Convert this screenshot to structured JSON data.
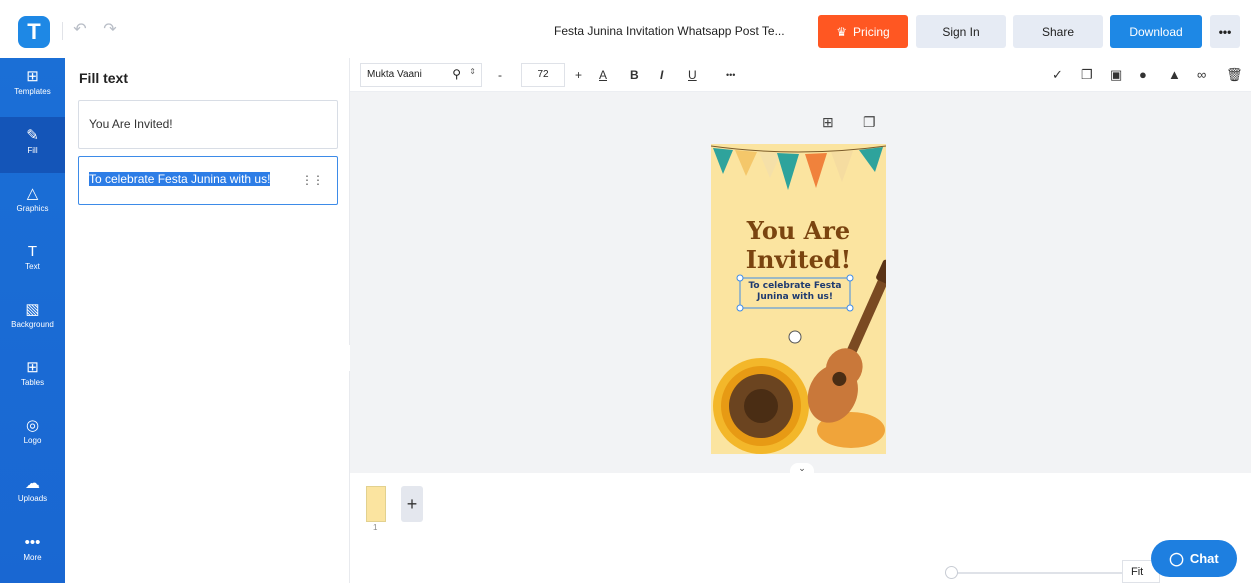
{
  "app": {
    "logo_letter": "T"
  },
  "header": {
    "doc_title": "Festa Junina Invitation Whatsapp Post Te...",
    "pricing_label": "Pricing",
    "signin_label": "Sign In",
    "share_label": "Share",
    "download_label": "Download",
    "more_label": "•••"
  },
  "rail": {
    "items": [
      {
        "label": "Templates",
        "icon": "templates-icon",
        "glyph": "⊞"
      },
      {
        "label": "Fill",
        "icon": "pencil-icon",
        "glyph": "✎"
      },
      {
        "label": "Graphics",
        "icon": "shapes-icon",
        "glyph": "△"
      },
      {
        "label": "Text",
        "icon": "text-icon",
        "glyph": "T"
      },
      {
        "label": "Background",
        "icon": "background-icon",
        "glyph": "▧"
      },
      {
        "label": "Tables",
        "icon": "table-icon",
        "glyph": "⊞"
      },
      {
        "label": "Logo",
        "icon": "logo-icon",
        "glyph": "◎"
      },
      {
        "label": "Uploads",
        "icon": "upload-cloud-icon",
        "glyph": "☁"
      },
      {
        "label": "More",
        "icon": "more-icon",
        "glyph": "•••"
      }
    ]
  },
  "panel": {
    "title": "Fill text",
    "fields": [
      {
        "value": "You Are Invited!"
      },
      {
        "value": "To celebrate Festa Junina with us!"
      }
    ]
  },
  "format_bar": {
    "font_name": "Mukta Vaani",
    "font_size": "72",
    "minus": "-",
    "plus": "+",
    "color_glyph": "A",
    "bold": "B",
    "italic": "I",
    "underline": "U",
    "more": "•••"
  },
  "poster": {
    "headline_line1": "You Are",
    "headline_line2": "Invited!",
    "subtext_line1": "To celebrate Festa",
    "subtext_line2": "Junina with us!"
  },
  "pages": {
    "page_number": "1",
    "add_label": "+"
  },
  "zoom": {
    "fit_label": "Fit"
  },
  "chat": {
    "label": "Chat"
  },
  "colors": {
    "accent": "#1e88e5",
    "pricing": "#ff5722",
    "rail": "#1b6fd6",
    "poster_bg": "#fbe4a0"
  }
}
